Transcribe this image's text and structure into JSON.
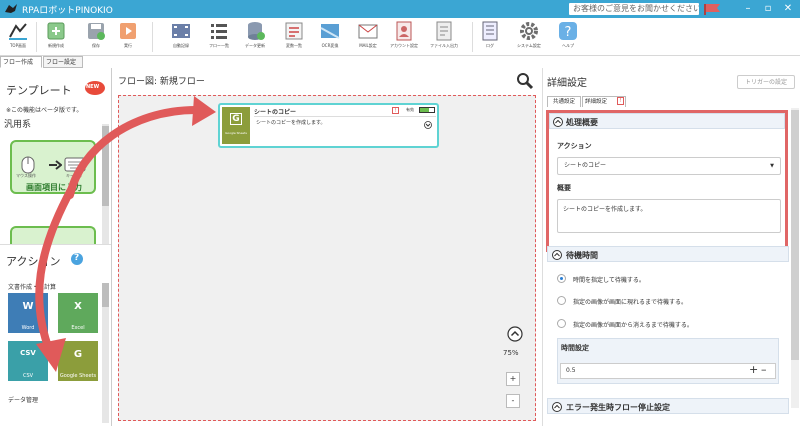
{
  "app": {
    "title": "RPAロボットPINOKIO",
    "feedback": "お客様のご意見をお聞かせください"
  },
  "toolbar": {
    "items": [
      {
        "label": "TOP画面",
        "icon": "top-screen-icon"
      },
      {
        "label": "新規作成",
        "icon": "new-file-icon"
      },
      {
        "label": "保存",
        "icon": "save-icon"
      },
      {
        "label": "実行",
        "icon": "run-icon"
      },
      {
        "label": "自動記録",
        "icon": "film-record-icon"
      },
      {
        "label": "フロー一覧",
        "icon": "list-icon"
      },
      {
        "label": "データ更新",
        "icon": "database-icon"
      },
      {
        "label": "変数一覧",
        "icon": "variables-icon"
      },
      {
        "label": "OCR変換",
        "icon": "ocr-icon"
      },
      {
        "label": "MAIL設定",
        "icon": "mail-icon"
      },
      {
        "label": "アカウント設定",
        "icon": "account-icon"
      },
      {
        "label": "ファイル入出力",
        "icon": "file-io-icon"
      },
      {
        "label": "ログ",
        "icon": "log-icon"
      },
      {
        "label": "システム設定",
        "icon": "gear-icon"
      },
      {
        "label": "ヘルプ",
        "icon": "help-icon"
      }
    ]
  },
  "tabs": {
    "flow_create": "フロー作成",
    "flow_settings": "フロー設定"
  },
  "left": {
    "template_title": "テンプレート",
    "new_badge": "NEW",
    "beta_note": "※この機能はベータ版です。",
    "category": "汎用系",
    "template_card": {
      "label": "画面項目に入力",
      "sub1": "マウス操作",
      "sub2": "キー操作"
    },
    "actions_title": "アクション",
    "help_glyph": "?",
    "category2": "文書作成・表計算",
    "actions": [
      {
        "label": "Word",
        "glyph": "W",
        "color": "#3e7db6"
      },
      {
        "label": "Excel",
        "glyph": "X",
        "color": "#5fa95c"
      },
      {
        "label": "CSV",
        "glyph": "CSV",
        "color": "#3aa0a8"
      },
      {
        "label": "Google Sheets",
        "glyph": "G",
        "color": "#8c9d3b"
      }
    ],
    "category3": "データ管理"
  },
  "canvas": {
    "title": "フロー図: 新規フロー",
    "zoom": "75%",
    "plus": "+",
    "minus": "-",
    "node": {
      "title": "シートのコピー",
      "status": "有効",
      "desc": "シートのコピーを作成します。",
      "icon_label": "Google Sheets",
      "icon_glyph": "G",
      "warn": "!"
    }
  },
  "right": {
    "title": "詳細設定",
    "trigger_button": "トリガーの設定",
    "tab_common": "共通設定",
    "tab_detail": "詳細設定",
    "warn": "!",
    "summary_section": "処理概要",
    "action_label": "アクション",
    "action_value": "シートのコピー",
    "overview_label": "概要",
    "overview_value": "シートのコピーを作成します。",
    "wait_section": "待機時間",
    "wait_options": [
      {
        "label": "時間を指定して待機する。",
        "selected": true
      },
      {
        "label": "指定の画像が画面に現れるまで待機する。",
        "selected": false
      },
      {
        "label": "指定の画像が画面から消えるまで待機する。",
        "selected": false
      }
    ],
    "time_label": "時間設定",
    "time_value": "0.5",
    "error_section": "エラー発生時フロー停止設定"
  },
  "colors": {
    "accent": "#3ba6d3",
    "highlight": "#e06666",
    "arrow": "#e05a5a",
    "node_border": "#5fd3d3"
  }
}
